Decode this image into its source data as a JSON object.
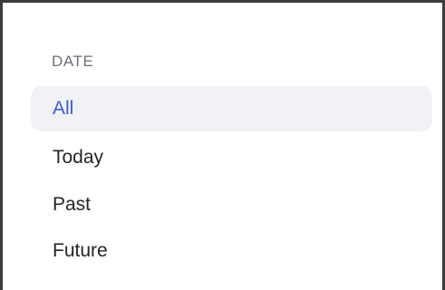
{
  "date_filter": {
    "heading": "DATE",
    "options": [
      {
        "label": "All",
        "selected": true
      },
      {
        "label": "Today",
        "selected": false
      },
      {
        "label": "Past",
        "selected": false
      },
      {
        "label": "Future",
        "selected": false
      }
    ]
  },
  "colors": {
    "selected_text": "#3b5bdb",
    "selected_background": "#f1f2f5",
    "heading_text": "#6b6f76",
    "option_text": "#232529",
    "border": "#3a3a3a"
  }
}
